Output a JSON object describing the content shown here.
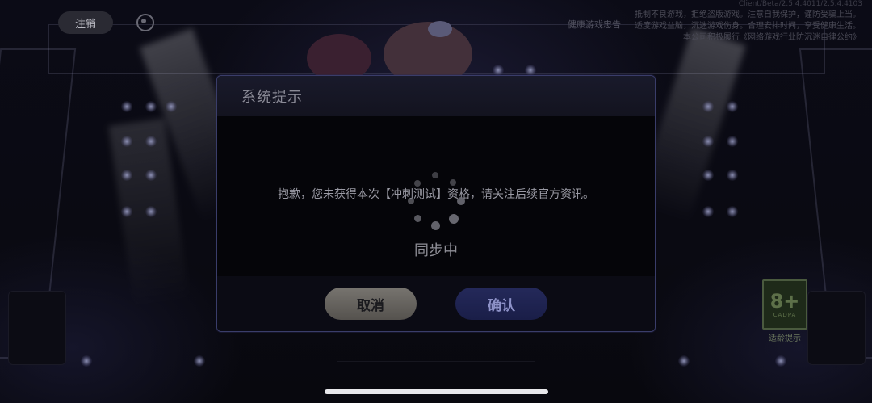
{
  "header": {
    "logout_label": "注销",
    "service_icon": "headset-icon",
    "health_notice_link": "健康游戏忠告",
    "version": "Client/Beta/2.5.4.4011/2.5.4.4103"
  },
  "health_notice": {
    "line1": "抵制不良游戏，拒绝盗版游戏。注意自我保护，谨防受骗上当。",
    "line2": "适度游戏益脑，沉迷游戏伤身。合理安排时间，享受健康生活。",
    "line3": "本公司积极履行《网络游戏行业防沉迷自律公约》"
  },
  "dialog": {
    "title": "系统提示",
    "message": "抱歉，您未获得本次【冲刺测试】资格，请关注后续官方资讯。",
    "cancel_label": "取消",
    "confirm_label": "确认"
  },
  "loading": {
    "text": "同步中"
  },
  "age_rating": {
    "value": "8+",
    "org": "CADPA",
    "tip": "适龄提示"
  },
  "colors": {
    "dialog_border": "#3a3d6a",
    "confirm_bg": "#1a1e48",
    "cancel_bg": "#55524e"
  }
}
